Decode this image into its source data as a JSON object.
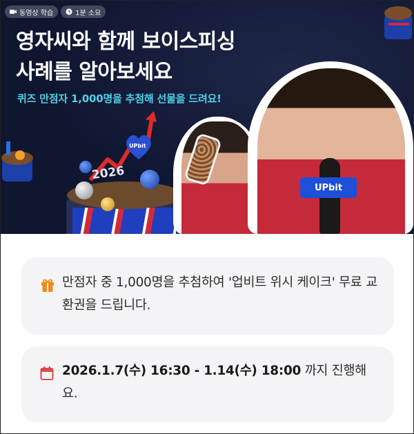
{
  "hero": {
    "badges": [
      {
        "icon": "video-camera-icon",
        "label": "동영상 학습"
      },
      {
        "icon": "clock-icon",
        "label": "1분 소요"
      }
    ],
    "title_line1": "영자씨와 함께 보이스피싱",
    "title_line2": "사례를 알아보세요",
    "subtitle": "퀴즈 만점자 1,000명을 추첨해 선물을 드려요!",
    "cake_text": "2026",
    "mic_brand": "UPbit",
    "balloon_brand": "UPbit",
    "colors": {
      "background": "#0f1630",
      "subtitle": "#4fd0e8"
    }
  },
  "cards": [
    {
      "icon": "gift-icon",
      "icon_color": "#f08a1c",
      "text": "만점자 중 1,000명을 추첨하여 '업비트 위시 케이크' 무료 교환권을 드립니다."
    },
    {
      "icon": "calendar-icon",
      "icon_color": "#e04a4a",
      "period": "2026.1.7(수) 16:30 - 1.14(수) 18:00",
      "suffix": " 까지 진행해요."
    }
  ]
}
